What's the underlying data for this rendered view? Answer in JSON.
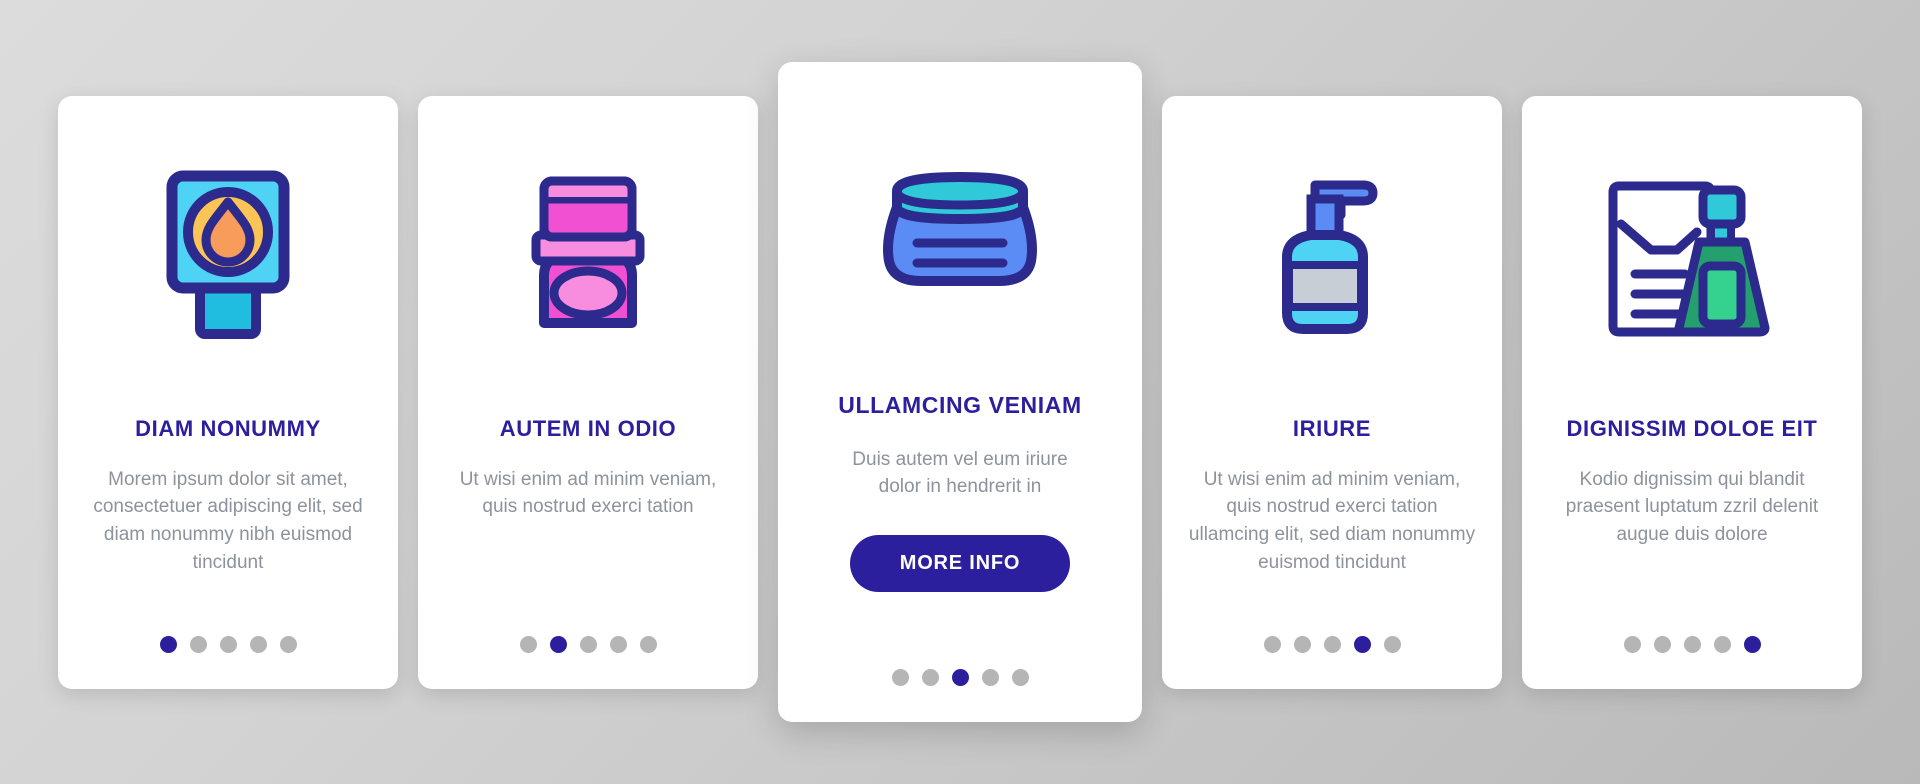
{
  "palette": {
    "background_light": "#dcdcdc",
    "background_dark": "#b9b9b9",
    "card_background": "#ffffff",
    "accent_indigo": "#2c1f9e",
    "title_color": "#2c1f9e",
    "body_text": "#8d939c",
    "dot_inactive": "#b5b5b5",
    "dot_active": "#2c1f9e",
    "icon_outline": "#2c2a8c",
    "icon_cyan": "#4fd3f5",
    "icon_cyan_dark": "#21bde0",
    "icon_yellow": "#fcc356",
    "icon_orange": "#f79c5a",
    "icon_pink_light": "#f88de0",
    "icon_pink": "#f250d2",
    "icon_blue": "#5b8cf5",
    "icon_teal": "#2fc9da",
    "icon_grey": "#c7ced6",
    "icon_green": "#23a06d",
    "icon_green_light": "#35d18f"
  },
  "cards": [
    {
      "icon": "lotion-tube-icon",
      "title": "DIAM NONUMMY",
      "description": "Morem ipsum dolor sit amet, consectetuer adipiscing elit, sed diam nonummy nibh euismod tincidunt",
      "featured": false,
      "cta_label": null,
      "dots": {
        "count": 5,
        "active_index": 0
      }
    },
    {
      "icon": "compact-powder-icon",
      "title": "AUTEM IN ODIO",
      "description": "Ut wisi enim ad minim veniam, quis nostrud exerci tation",
      "featured": false,
      "cta_label": null,
      "dots": {
        "count": 5,
        "active_index": 1
      }
    },
    {
      "icon": "cream-jar-icon",
      "title": "ULLAMCING VENIAM",
      "description": "Duis autem vel eum iriure dolor in hendrerit in",
      "featured": true,
      "cta_label": "MORE INFO",
      "dots": {
        "count": 5,
        "active_index": 2
      }
    },
    {
      "icon": "pump-dispenser-icon",
      "title": "IRIURE",
      "description": "Ut wisi enim ad minim veniam, quis nostrud exerci tation ullamcing elit, sed diam nonummy euismod tincidunt",
      "featured": false,
      "cta_label": null,
      "dots": {
        "count": 5,
        "active_index": 3
      }
    },
    {
      "icon": "bottle-document-icon",
      "title": "DIGNISSIM DOLOE EIT",
      "description": "Kodio dignissim qui blandit praesent luptatum zzril delenit augue duis dolore",
      "featured": false,
      "cta_label": null,
      "dots": {
        "count": 5,
        "active_index": 4
      }
    }
  ]
}
